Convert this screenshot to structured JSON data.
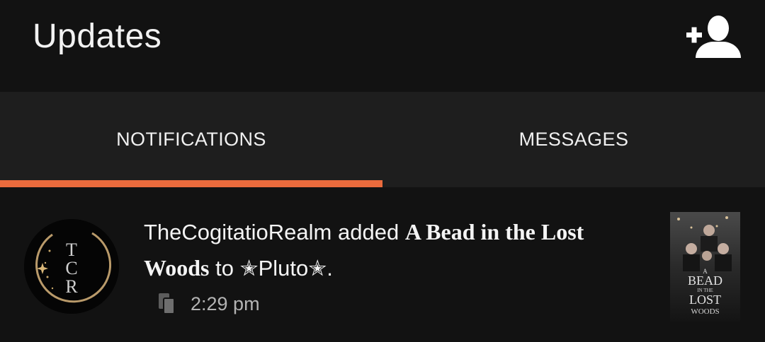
{
  "header": {
    "title": "Updates",
    "add_user_icon": "add-user-icon"
  },
  "tabs": [
    {
      "label": "NOTIFICATIONS",
      "active": true
    },
    {
      "label": "MESSAGES",
      "active": false
    }
  ],
  "colors": {
    "accent": "#ea6b3d",
    "background": "#121212",
    "tab_bar": "#1e1e1e"
  },
  "notification": {
    "user": "TheCogitatioRealm",
    "action": "added",
    "story_title": "A Bead in the Lost Woods",
    "connector": "to",
    "list_name": "✭Pluto✭",
    "end": ".",
    "time": "2:29 pm",
    "avatar_letters": "TCR",
    "cover": {
      "line1": "A",
      "line2": "BEAD",
      "line3": "IN THE",
      "line4": "LOST",
      "line5": "WOODS"
    }
  }
}
